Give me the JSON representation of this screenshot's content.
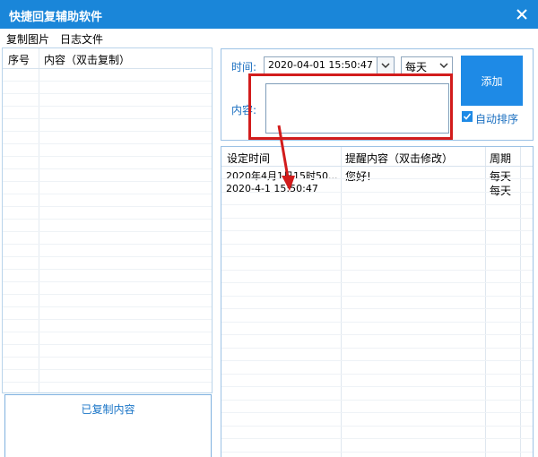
{
  "window": {
    "title": "快捷回复辅助软件",
    "colors": {
      "titlebar": "#1a86d9",
      "accent": "#1e8ae6",
      "annotation": "#d21c1c"
    }
  },
  "menu": [
    "复制图片",
    "日志文件"
  ],
  "left_table": {
    "columns": [
      "序号",
      "内容（双击复制）"
    ]
  },
  "copied_panel": {
    "title": "已复制内容"
  },
  "form": {
    "time_label": "时间:",
    "time_value": "2020-04-01 15:50:47",
    "period_value": "每天",
    "content_label": "内容:",
    "content_value": "",
    "add_button": "添加",
    "auto_sort_label": "自动排序",
    "auto_sort_checked": true
  },
  "schedule_table": {
    "columns": [
      "设定时间",
      "提醒内容（双击修改）",
      "周期"
    ],
    "rows": [
      {
        "time": "2020年4月1日15时50...",
        "content": "您好!",
        "period": "每天"
      },
      {
        "time": "2020-4-1 15:50:47",
        "content": "",
        "period": "每天"
      }
    ]
  },
  "icons": {
    "close": "close-icon",
    "dropdown": "chevron-down-icon",
    "checkbox": "check-icon"
  }
}
